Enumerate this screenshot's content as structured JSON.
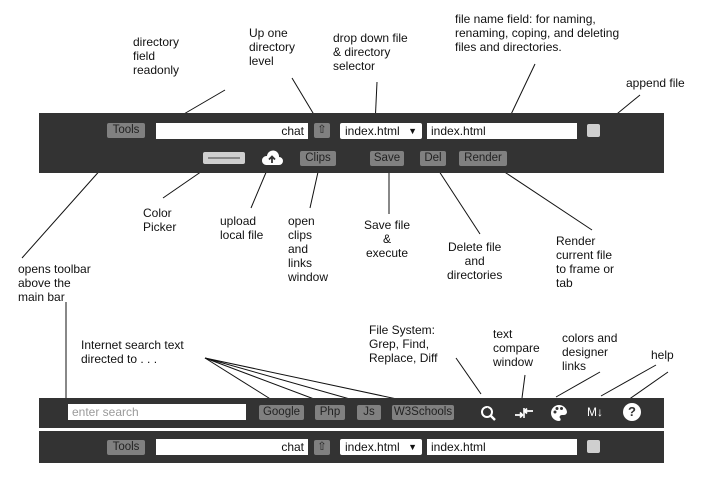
{
  "annotations": {
    "directory_field": [
      "directory",
      "field",
      "readonly"
    ],
    "up_one": [
      "Up one",
      "directory",
      "level"
    ],
    "dropdown": [
      "drop down file",
      "& directory",
      "selector"
    ],
    "file_name": [
      "file name field: for naming,",
      "renaming, coping, and deleting",
      "files and directories."
    ],
    "append": [
      "append file"
    ],
    "color_picker": [
      "Color",
      "Picker"
    ],
    "upload": [
      "upload",
      "local file"
    ],
    "open_clips": [
      "open",
      "clips",
      "and",
      "links",
      "window"
    ],
    "save": [
      "Save file",
      "&",
      "execute"
    ],
    "delete": [
      "Delete file",
      "and",
      "directories"
    ],
    "render": [
      "Render",
      "current file",
      "to frame or",
      "tab"
    ],
    "opens_toolbar": [
      "opens toolbar",
      "above the",
      "main bar"
    ],
    "internet_search": [
      "Internet search text",
      "directed to . . ."
    ],
    "file_system": [
      "File System:",
      "Grep, Find,",
      "Replace, Diff"
    ],
    "text_compare": [
      "text",
      "compare",
      "window"
    ],
    "colors_designer": [
      "colors and",
      "designer",
      "links"
    ],
    "help": [
      "help"
    ]
  },
  "top_bar": {
    "tools_label": "Tools",
    "directory_value": "chat",
    "up_glyph": "⇧",
    "dropdown_value": "index.html",
    "dropdown_arrow": "▼",
    "filename_value": "index.html",
    "clips_label": "Clips",
    "save_label": "Save",
    "del_label": "Del",
    "render_label": "Render"
  },
  "search_bar": {
    "search_placeholder": "enter search",
    "google_label": "Google",
    "php_label": "Php",
    "js_label": "Js",
    "w3_label": "W3Schools",
    "markdown_glyph": "M↓",
    "help_glyph": "?"
  },
  "bottom_bar": {
    "tools_label": "Tools",
    "directory_value": "chat",
    "up_glyph": "⇧",
    "dropdown_value": "index.html",
    "dropdown_arrow": "▼",
    "filename_value": "index.html"
  },
  "colors": {
    "bar": "#333333",
    "button": "#808080",
    "field": "#ffffff",
    "checkbox": "#cfcfcf",
    "icon": "#ffffff"
  },
  "icons": [
    "upload-cloud-icon",
    "search-refresh-icon",
    "compare-arrows-icon",
    "palette-icon",
    "markdown-icon",
    "help-icon",
    "color-picker-swatch"
  ]
}
